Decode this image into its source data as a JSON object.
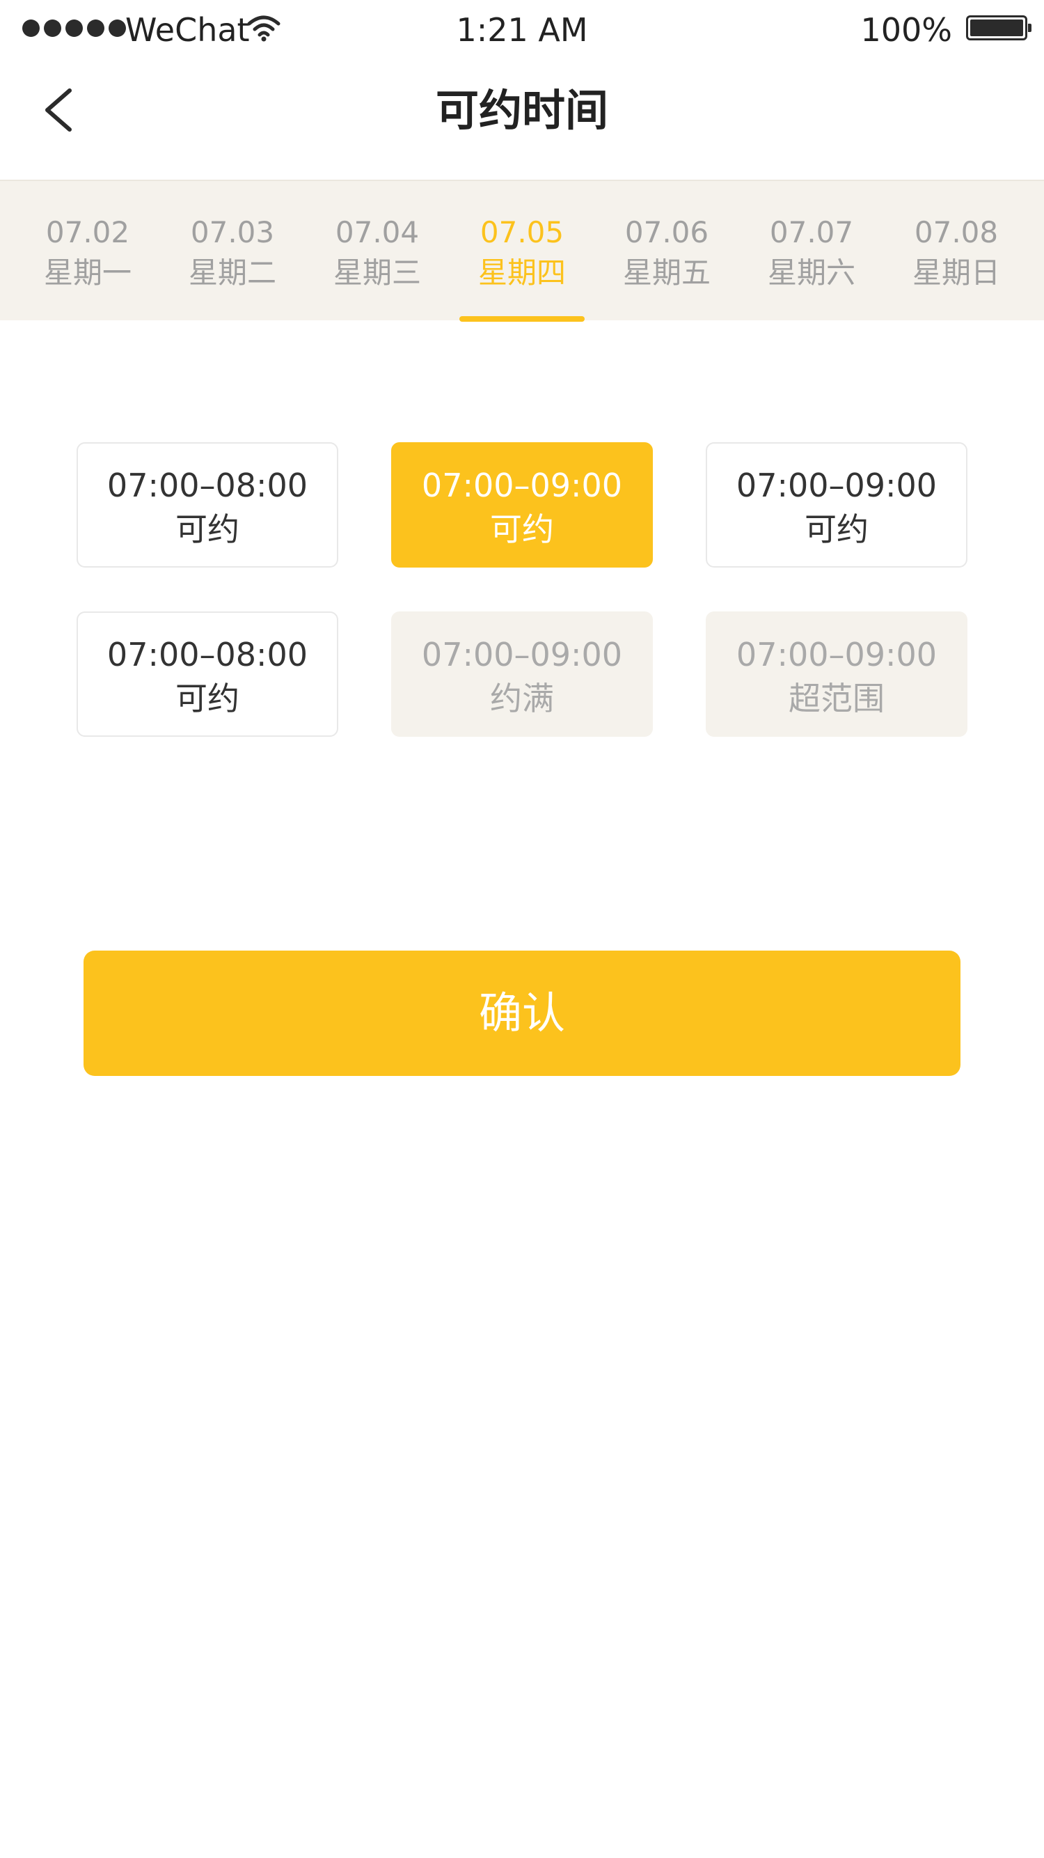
{
  "status_bar": {
    "carrier": "WeChat",
    "time": "1:21 AM",
    "battery": "100%"
  },
  "nav": {
    "title": "可约时间"
  },
  "date_tabs": [
    {
      "date": "07.02",
      "weekday": "星期一",
      "active": false
    },
    {
      "date": "07.03",
      "weekday": "星期二",
      "active": false
    },
    {
      "date": "07.04",
      "weekday": "星期三",
      "active": false
    },
    {
      "date": "07.05",
      "weekday": "星期四",
      "active": true
    },
    {
      "date": "07.06",
      "weekday": "星期五",
      "active": false
    },
    {
      "date": "07.07",
      "weekday": "星期六",
      "active": false
    },
    {
      "date": "07.08",
      "weekday": "星期日",
      "active": false
    }
  ],
  "slots": [
    {
      "time": "07:00–08:00",
      "status": "可约",
      "state": "available"
    },
    {
      "time": "07:00–09:00",
      "status": "可约",
      "state": "selected"
    },
    {
      "time": "07:00–09:00",
      "status": "可约",
      "state": "available"
    },
    {
      "time": "07:00–08:00",
      "status": "可约",
      "state": "available"
    },
    {
      "time": "07:00–09:00",
      "status": "约满",
      "state": "disabled"
    },
    {
      "time": "07:00–09:00",
      "status": "超范围",
      "state": "disabled"
    }
  ],
  "confirm_label": "确认",
  "colors": {
    "accent": "#fcc21d",
    "tab_bg": "#f5f2ec",
    "muted_text": "#a0a0a0"
  }
}
